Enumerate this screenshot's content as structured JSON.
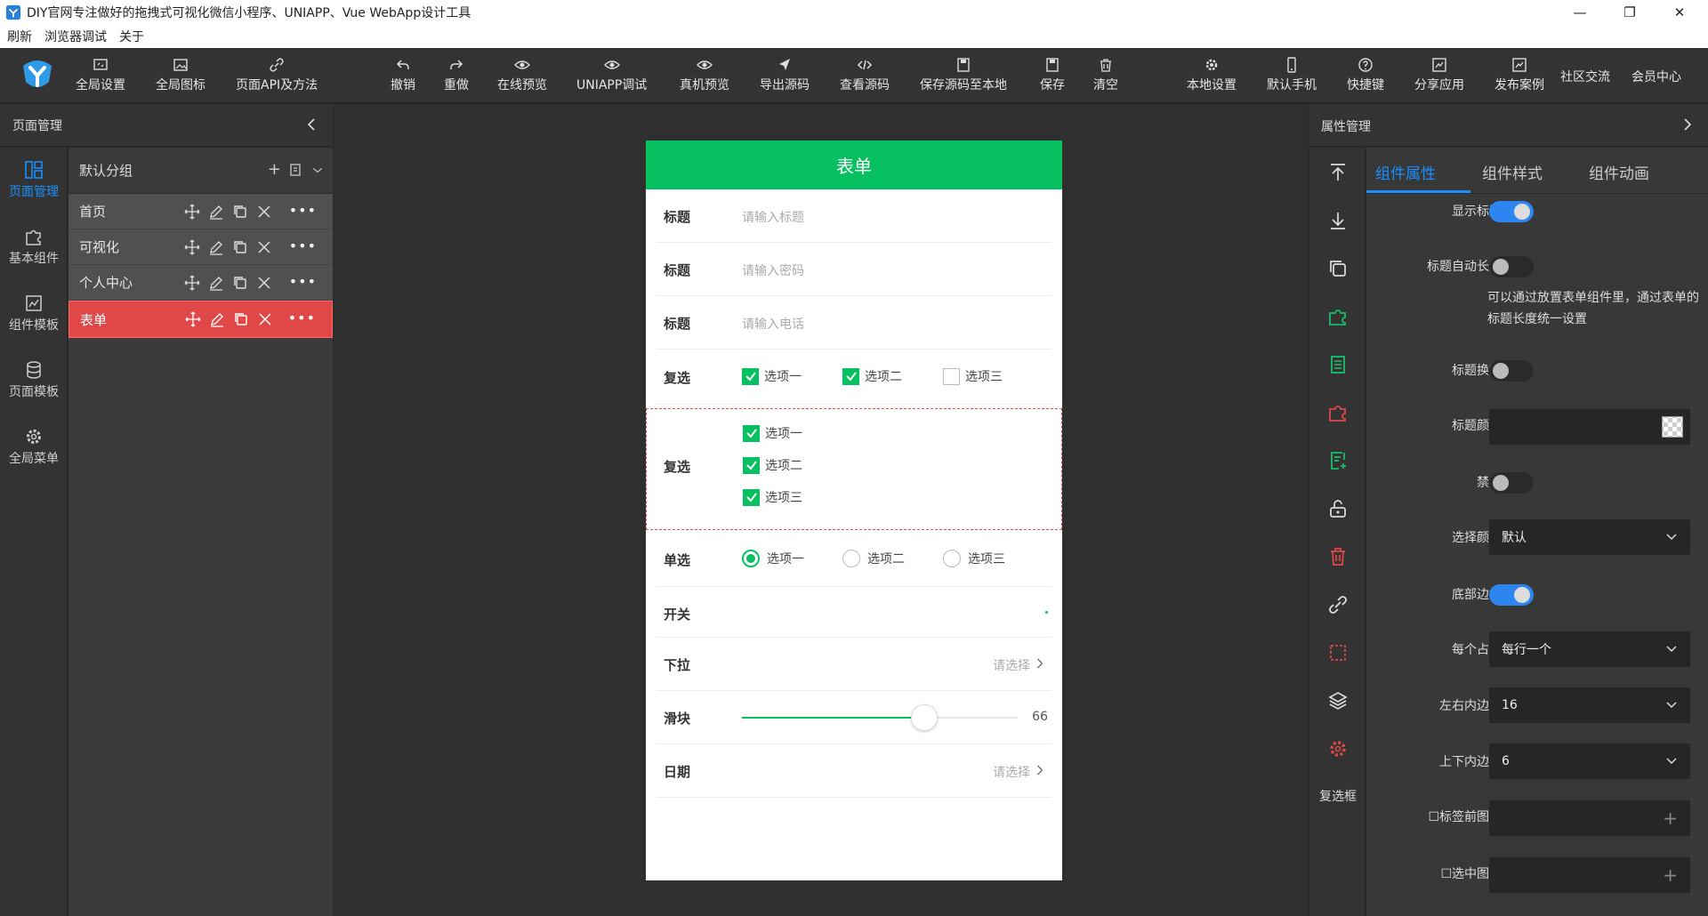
{
  "window": {
    "title": "DIY官网专注做好的拖拽式可视化微信小程序、UNIAPP、Vue WebApp设计工具",
    "controls": [
      "minimize",
      "maximize",
      "close"
    ]
  },
  "menubar": [
    "刷新",
    "浏览器调试",
    "关于"
  ],
  "toolbar": {
    "left": [
      {
        "label": "全局设置",
        "icon": "settings-window-icon"
      },
      {
        "label": "全局图标",
        "icon": "image-icon"
      },
      {
        "label": "页面API及方法",
        "icon": "link-icon"
      }
    ],
    "center": [
      {
        "label": "撤销",
        "icon": "undo-icon"
      },
      {
        "label": "重做",
        "icon": "redo-icon"
      },
      {
        "label": "在线预览",
        "icon": "eye-icon"
      },
      {
        "label": "UNIAPP调试",
        "icon": "eye-icon"
      },
      {
        "label": "真机预览",
        "icon": "eye-icon"
      },
      {
        "label": "导出源码",
        "icon": "send-icon"
      },
      {
        "label": "查看源码",
        "icon": "code-icon"
      },
      {
        "label": "保存源码至本地",
        "icon": "save-icon"
      },
      {
        "label": "保存",
        "icon": "save-icon"
      },
      {
        "label": "清空",
        "icon": "trash-icon"
      }
    ],
    "right": [
      {
        "label": "本地设置",
        "icon": "gear-icon"
      },
      {
        "label": "默认手机",
        "icon": "phone-icon"
      },
      {
        "label": "快捷键",
        "icon": "help-icon"
      },
      {
        "label": "分享应用",
        "icon": "share-icon"
      },
      {
        "label": "发布案例",
        "icon": "publish-icon"
      },
      {
        "label": "社区交流",
        "icon": ""
      },
      {
        "label": "会员中心",
        "icon": ""
      }
    ]
  },
  "rail": [
    {
      "label": "页面管理",
      "active": true
    },
    {
      "label": "基本组件",
      "active": false
    },
    {
      "label": "组件模板",
      "active": false
    },
    {
      "label": "页面模板",
      "active": false
    },
    {
      "label": "全局菜单",
      "active": false
    }
  ],
  "page_manager": {
    "title": "页面管理",
    "group": "默认分组",
    "pages": [
      {
        "name": "首页",
        "active": false
      },
      {
        "name": "可视化",
        "active": false
      },
      {
        "name": "个人中心",
        "active": false
      },
      {
        "name": "表单",
        "active": true
      }
    ],
    "more": "•••"
  },
  "phone": {
    "header": "表单",
    "inputs": [
      {
        "label": "标题",
        "placeholder": "请输入标题"
      },
      {
        "label": "标题",
        "placeholder": "请输入密码"
      },
      {
        "label": "标题",
        "placeholder": "请输入电话"
      }
    ],
    "checkbox_inline": {
      "label": "复选",
      "options": [
        {
          "text": "选项一",
          "checked": true
        },
        {
          "text": "选项二",
          "checked": true
        },
        {
          "text": "选项三",
          "checked": false
        }
      ]
    },
    "checkbox_block": {
      "label": "复选",
      "options": [
        {
          "text": "选项一",
          "checked": true
        },
        {
          "text": "选项二",
          "checked": true
        },
        {
          "text": "选项三",
          "checked": true
        }
      ]
    },
    "radio": {
      "label": "单选",
      "options": [
        {
          "text": "选项一",
          "checked": true
        },
        {
          "text": "选项二",
          "checked": false
        },
        {
          "text": "选项三",
          "checked": false
        }
      ]
    },
    "switch": {
      "label": "开关"
    },
    "dropdown": {
      "label": "下拉",
      "placeholder": "请选择"
    },
    "slider": {
      "label": "滑块",
      "value": "66",
      "fraction": 0.66
    },
    "date": {
      "label": "日期",
      "placeholder": "请选择"
    }
  },
  "tools": {
    "icons": [
      "move-top-icon",
      "move-bottom-icon",
      "copy-icon",
      "puzzle-icon",
      "document-icon",
      "puzzle-red-icon",
      "add-document-icon",
      "unlock-icon",
      "trash-icon",
      "link-icon",
      "selection-icon",
      "layers-icon",
      "gear-red-icon"
    ],
    "label": "复选框"
  },
  "properties": {
    "title": "属性管理",
    "tabs": [
      {
        "label": "组件属性",
        "active": true
      },
      {
        "label": "组件样式",
        "active": false
      },
      {
        "label": "组件动画",
        "active": false
      }
    ],
    "fields": {
      "show_title": {
        "label": "显示标题",
        "on": true
      },
      "auto_width": {
        "label": "标题自动长度",
        "on": false,
        "note": "可以通过放置表单组件里，通过表单的标题长度统一设置"
      },
      "title_wrap": {
        "label": "标题换行",
        "on": false
      },
      "title_color": {
        "label": "标题颜色"
      },
      "disabled": {
        "label": "禁用",
        "on": false
      },
      "select_color": {
        "label": "选择颜色",
        "value": "默认"
      },
      "bottom_border": {
        "label": "底部边框",
        "on": true
      },
      "per_row": {
        "label": "每个占比",
        "value": "每行一个"
      },
      "padding_lr": {
        "label": "左右内边距",
        "value": "16"
      },
      "padding_tb": {
        "label": "上下内边距",
        "value": "6"
      },
      "label_img": {
        "label": "标签前图片"
      },
      "checked_img": {
        "label": "选中图片"
      }
    }
  },
  "colors": {
    "accent": "#1890ff",
    "green": "#07c160",
    "active_row": "#e04848",
    "tool_green": "#19be6b",
    "tool_red": "#e04848"
  }
}
